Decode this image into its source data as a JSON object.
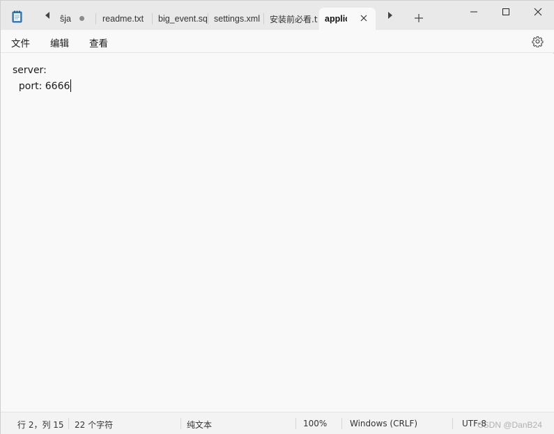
{
  "tabs": [
    {
      "label": "ŝja",
      "modified": true
    },
    {
      "label": "readme.txt",
      "modified": false
    },
    {
      "label": "big_event.sq",
      "modified": false
    },
    {
      "label": "settings.xml",
      "modified": false
    },
    {
      "label": "安装前必看.t",
      "modified": false
    },
    {
      "label": "applic",
      "modified": false,
      "active": true
    }
  ],
  "menu": {
    "file": "文件",
    "edit": "编辑",
    "view": "查看"
  },
  "editor": {
    "lines": [
      "server:",
      "  port: 6666"
    ]
  },
  "status": {
    "position": "行 2，列 15",
    "char_count": "22 个字符",
    "format": "纯文本",
    "zoom": "100%",
    "line_ending": "Windows (CRLF)",
    "encoding": "UTF-8"
  },
  "watermark": "CSDN @DanB24",
  "icons": {
    "app": "notepad-icon",
    "prev": "scroll-left-icon",
    "next": "scroll-right-icon",
    "new_tab": "plus-icon",
    "close_tab": "close-icon",
    "settings": "gear-icon",
    "minimize": "minimize-icon",
    "maximize": "maximize-icon",
    "close_window": "close-icon"
  }
}
